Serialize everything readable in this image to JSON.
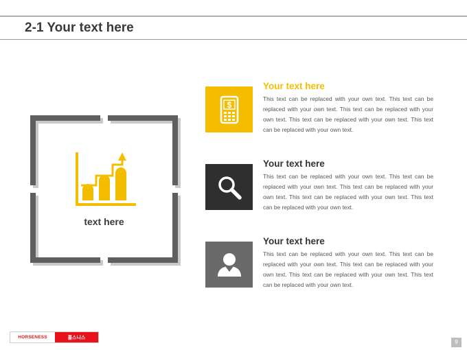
{
  "header": {
    "title": "2-1 Your text here"
  },
  "graphic": {
    "label": "text here",
    "icon": "bar-chart-growth-icon",
    "accent_color": "#f5bd00",
    "frame_color": "#5f5f5f"
  },
  "items": [
    {
      "title": "Your text here",
      "title_color": "#f5bd00",
      "icon": "mobile-dollar-icon",
      "icon_bg": "#f5bd00",
      "text": "This text can be replaced with your own text. This text can be replaced with your own text. This text can be replaced with your own text. This text can be replaced with your own text. This text can be replaced with your own text."
    },
    {
      "title": "Your text here",
      "title_color": "#333333",
      "icon": "magnifier-icon",
      "icon_bg": "#2f2f2f",
      "text": "This text can be replaced with your own text. This text can be replaced with your own text. This text can be replaced with your own text. This text can be replaced with your own text. This text can be replaced with your own text."
    },
    {
      "title": "Your text here",
      "title_color": "#333333",
      "icon": "user-icon",
      "icon_bg": "#6a6a6a",
      "text": "This text can be replaced with your own text. This text can be replaced with your own text. This text can be replaced with your own text. This text can be replaced with your own text. This text can be replaced with your own text."
    }
  ],
  "footer": {
    "logo_left": "HORSENESS",
    "logo_right": "홀스니스",
    "page_number": "9"
  }
}
